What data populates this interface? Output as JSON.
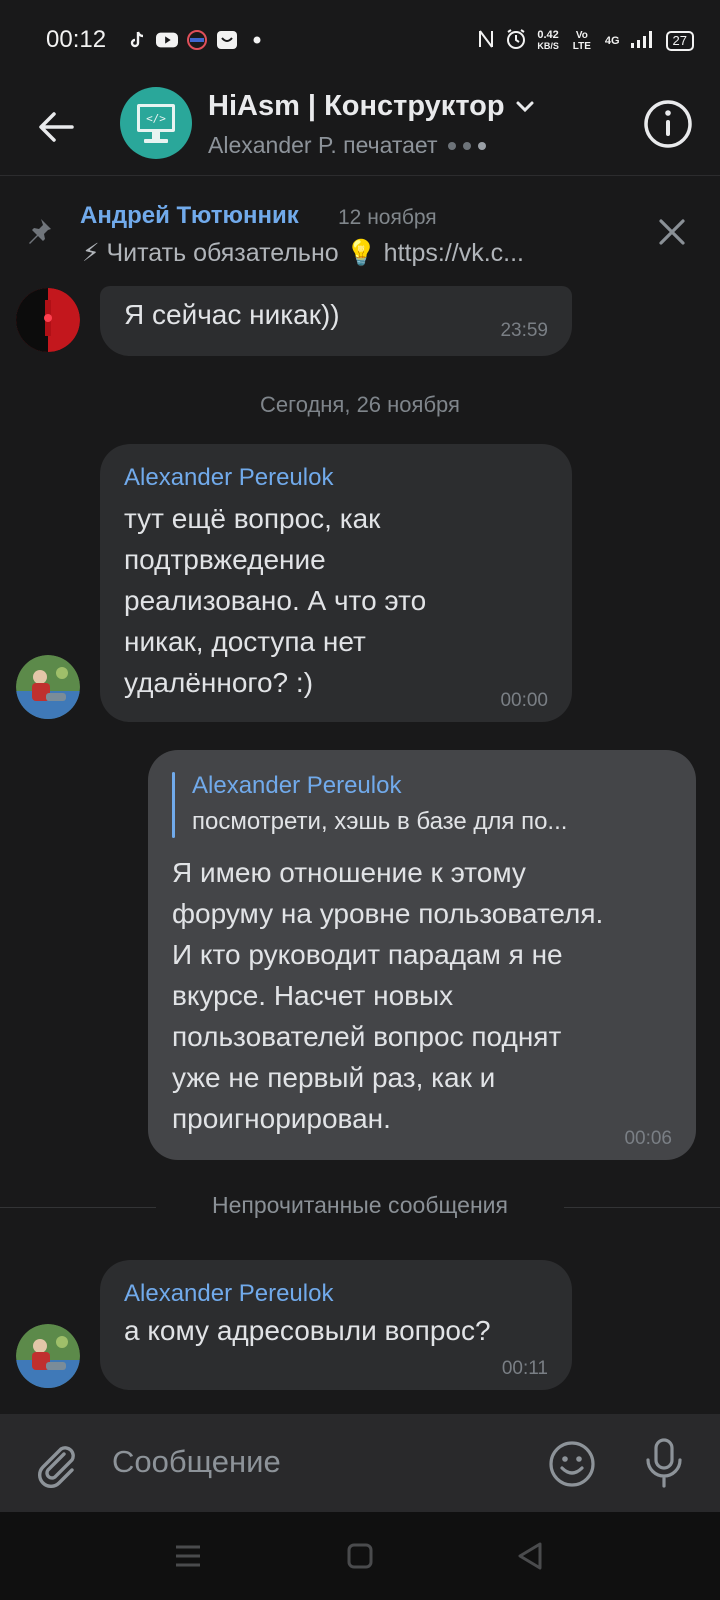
{
  "status_bar": {
    "time": "00:12",
    "net_speed_value": "0.42",
    "net_speed_unit": "KB/S",
    "volte": "Vo LTE",
    "network": "4G",
    "battery": "27"
  },
  "header": {
    "title": "HiAsm | Конструктор",
    "subtitle": "Alexander P. печатает"
  },
  "pinned": {
    "author": "Андрей Тютюнник",
    "date": "12 ноября",
    "text": "⚡ Читать обязательно 💡 https://vk.c..."
  },
  "messages": [
    {
      "text": "Я сейчас никак))",
      "time": "23:59"
    },
    {
      "author": "Alexander Pereulok",
      "text_lines": [
        "тут ещё вопрос, как",
        "подтрвжедение",
        "реализовано. А что это",
        "никак, доступа нет",
        "удалённого? :)"
      ],
      "time": "00:00"
    },
    {
      "reply_author": "Alexander Pereulok",
      "reply_text": "посмотрети, хэшь в базе для по...",
      "text_lines": [
        "Я имею отношение к этому",
        "форуму на уровне пользователя.",
        "И кто руководит парадам я не",
        "вкурсе. Насчет новых",
        "пользователей вопрос поднят",
        "уже не первый раз, как и",
        "проигнорирован."
      ],
      "time": "00:06"
    },
    {
      "author": "Alexander Pereulok",
      "text": "а кому адресовыли вопрос?",
      "time": "00:11"
    }
  ],
  "separators": {
    "date": "Сегодня, 26 ноября",
    "unread": "Непрочитанные сообщения"
  },
  "composer": {
    "placeholder": "Сообщение"
  },
  "colors": {
    "background": "#19191a",
    "accent": "#71aaeb",
    "bubble_in": "#2c2d2f",
    "bubble_out": "#444548"
  }
}
